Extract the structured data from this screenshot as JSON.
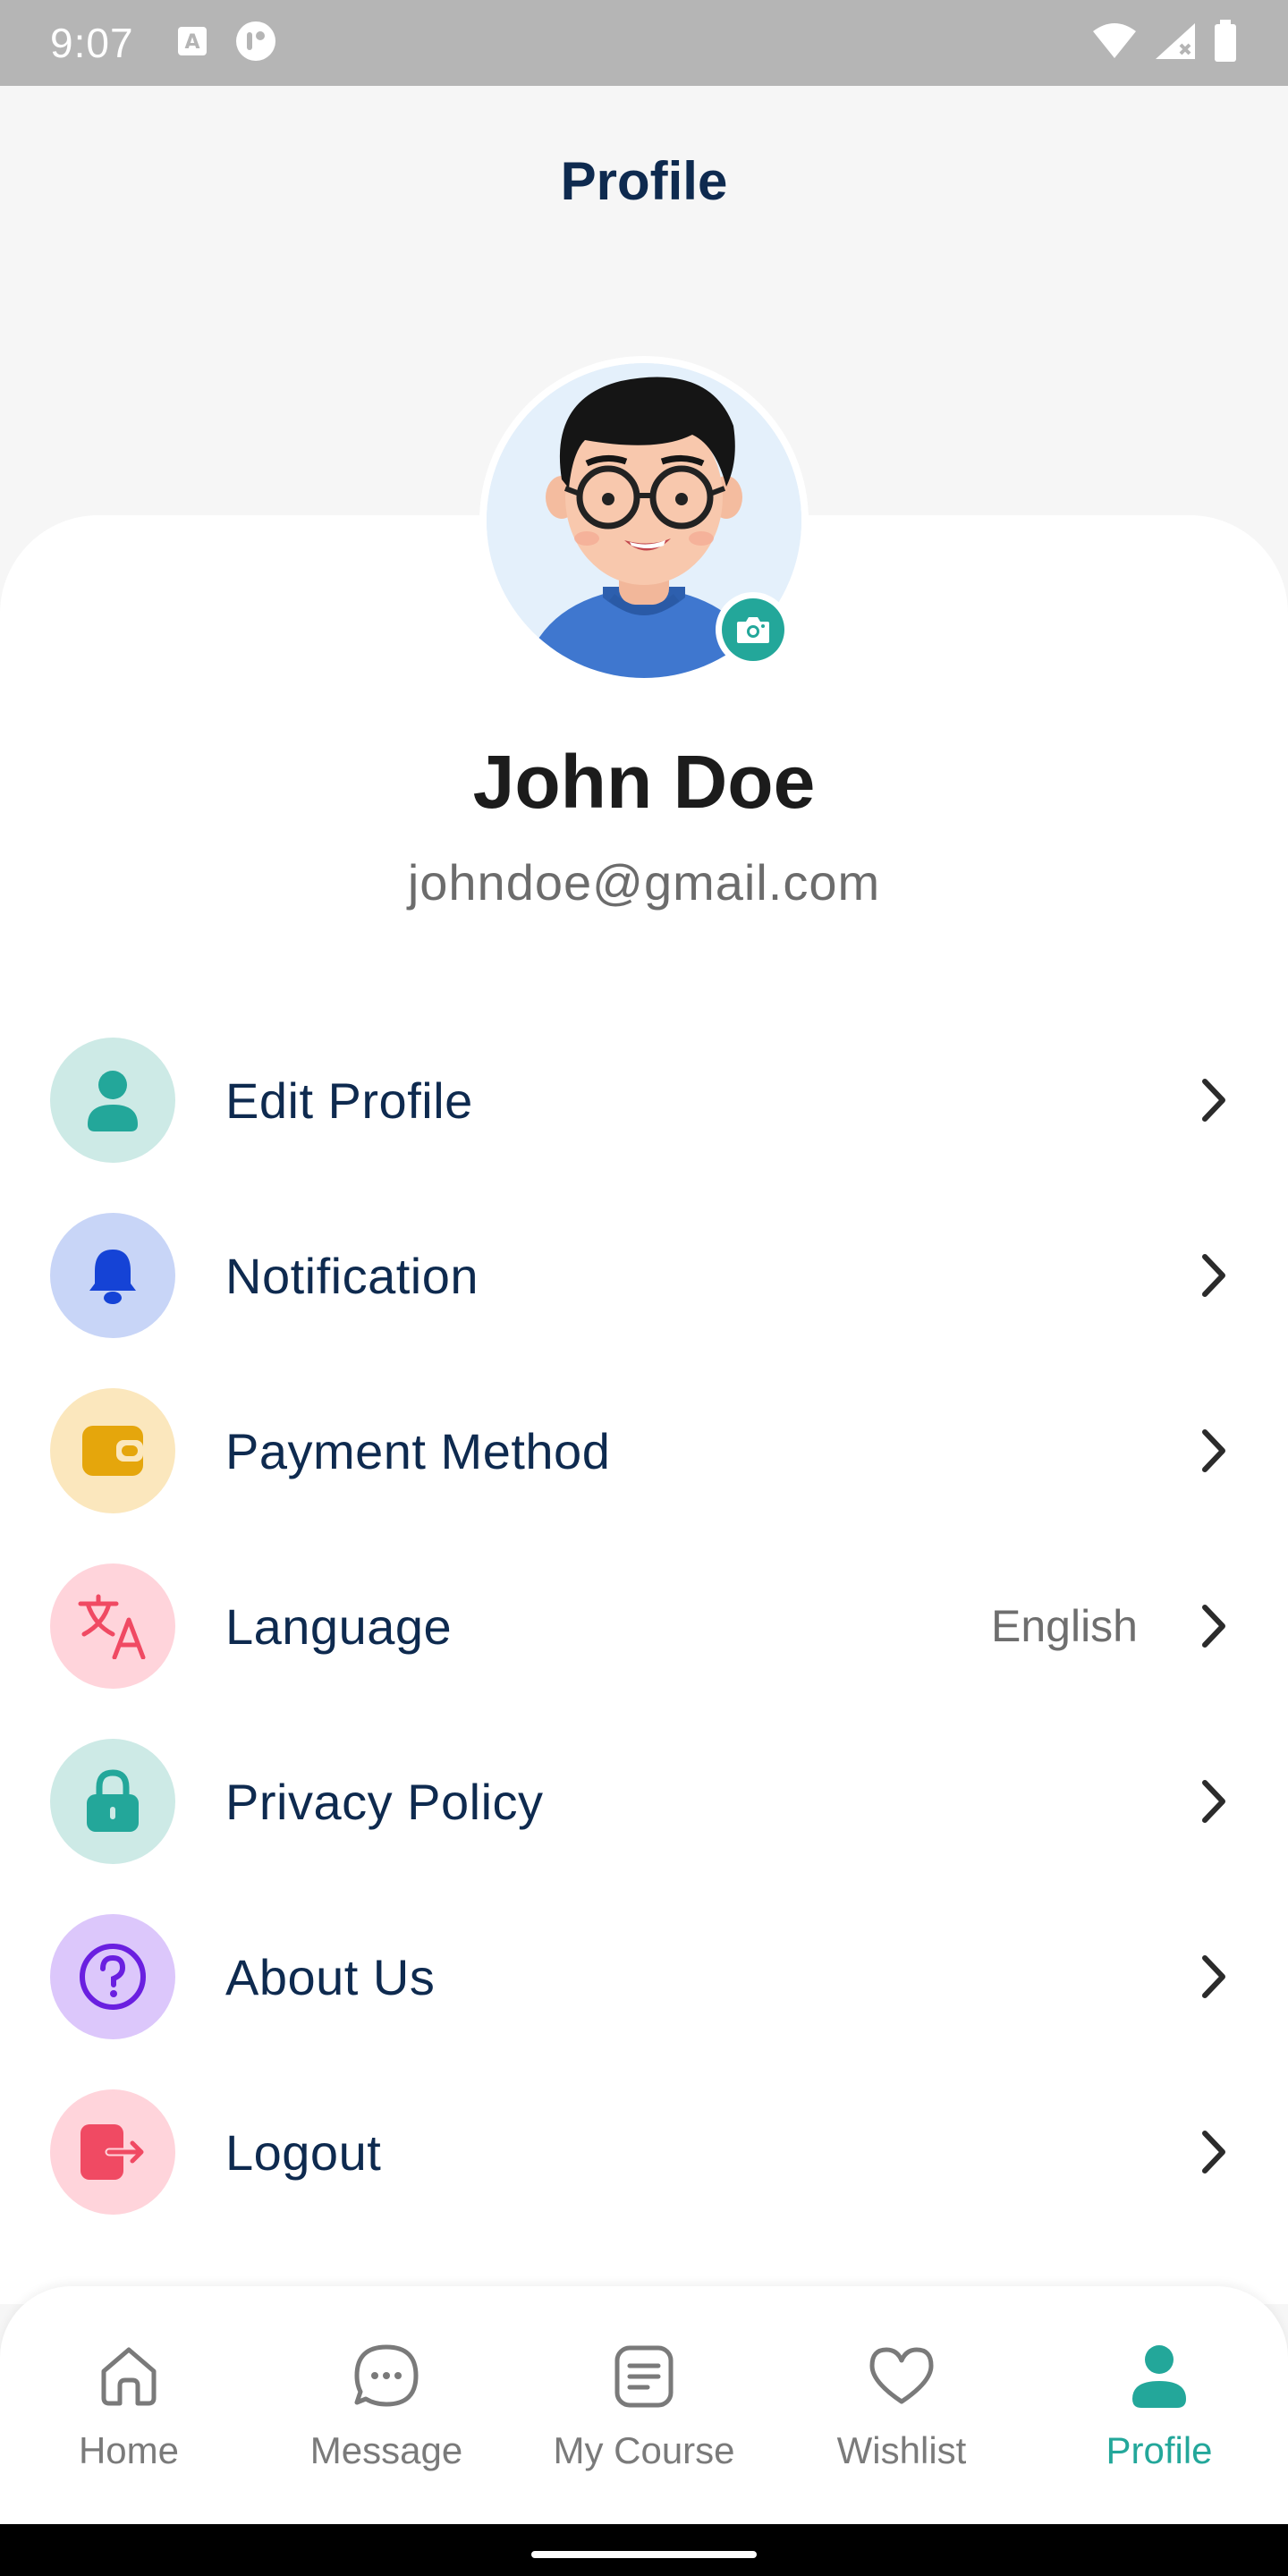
{
  "status_bar": {
    "time": "9:07",
    "icons": [
      "a-icon",
      "cast-icon",
      "wifi-icon",
      "signal-icon",
      "battery-icon"
    ]
  },
  "header": {
    "title": "Profile"
  },
  "profile": {
    "name": "John Doe",
    "email": "johndoe@gmail.com",
    "avatar_icon": "user-avatar",
    "camera_icon": "camera-icon"
  },
  "menu": {
    "items": [
      {
        "label": "Edit Profile",
        "icon": "person-icon",
        "bg": "#cdeae6",
        "color": "#23a79a"
      },
      {
        "label": "Notification",
        "icon": "bell-icon",
        "bg": "#c8d5f7",
        "color": "#1543d6"
      },
      {
        "label": "Payment Method",
        "icon": "wallet-icon",
        "bg": "#fbe7bd",
        "color": "#e5a60c"
      },
      {
        "label": "Language",
        "value": "English",
        "icon": "translate-icon",
        "bg": "#ffd4db",
        "color": "#f04a63"
      },
      {
        "label": "Privacy Policy",
        "icon": "lock-icon",
        "bg": "#cdeae6",
        "color": "#23a79a"
      },
      {
        "label": "About Us",
        "icon": "help-icon",
        "bg": "#dcc7fb",
        "color": "#6a1fe0"
      },
      {
        "label": "Logout",
        "icon": "logout-icon",
        "bg": "#ffd4db",
        "color": "#f04a63"
      }
    ]
  },
  "bottom_nav": {
    "items": [
      {
        "label": "Home",
        "icon": "home-icon",
        "active": false
      },
      {
        "label": "Message",
        "icon": "message-icon",
        "active": false
      },
      {
        "label": "My Course",
        "icon": "course-icon",
        "active": false
      },
      {
        "label": "Wishlist",
        "icon": "heart-icon",
        "active": false
      },
      {
        "label": "Profile",
        "icon": "profile-icon",
        "active": true
      }
    ],
    "active_color": "#23a79a",
    "inactive_color": "#7a7a7a"
  }
}
